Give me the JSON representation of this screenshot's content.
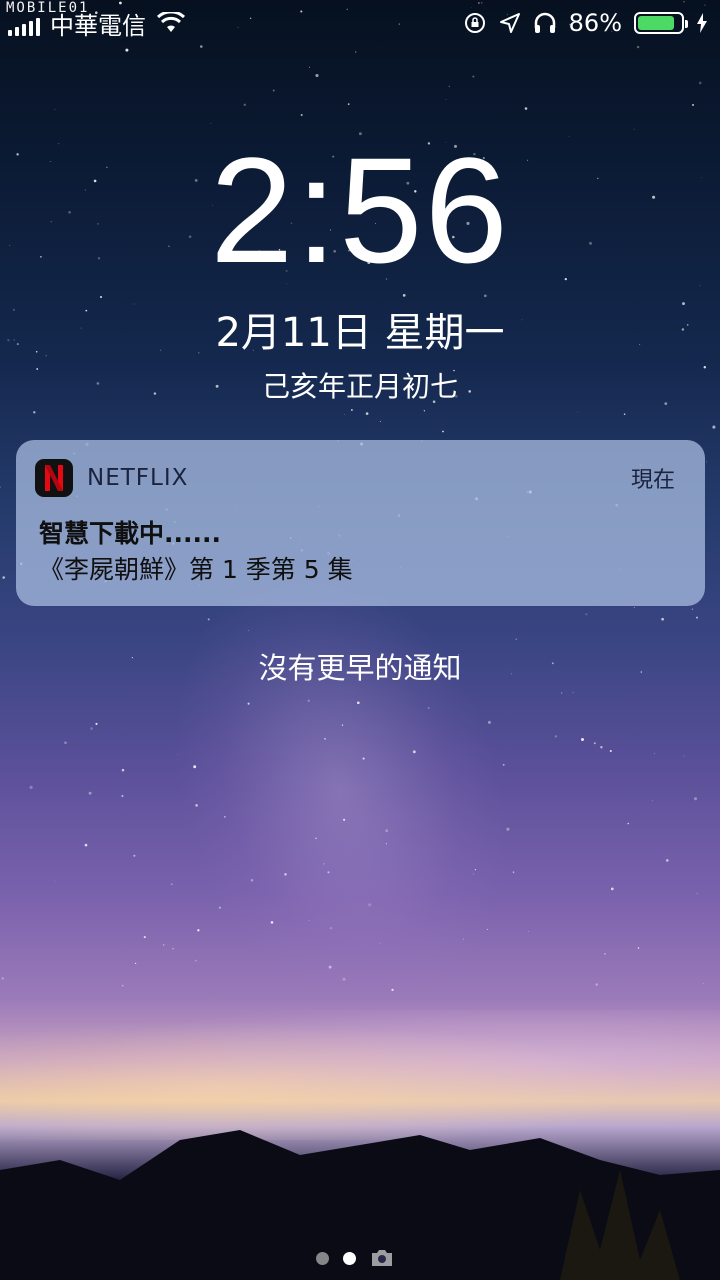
{
  "status_bar": {
    "watermark": "MOBILE01",
    "carrier": "中華電信",
    "battery_text": "86%",
    "battery_level": 0.86,
    "battery_color": "#4cd964",
    "icons": [
      "signal-icon",
      "wifi-icon",
      "rotation-lock-icon",
      "location-icon",
      "headphones-icon",
      "battery-icon",
      "charging-icon"
    ]
  },
  "lock_screen": {
    "time": "2:56",
    "date": "2月11日 星期一",
    "lunar_date": "己亥年正月初七"
  },
  "notification": {
    "app_name": "NETFLIX",
    "app_icon": "netflix-icon",
    "time": "現在",
    "title": "智慧下載中......",
    "body": "《李屍朝鮮》第 1 季第 5 集"
  },
  "no_earlier_notifications": "沒有更早的通知",
  "page_indicator": {
    "pages": 2,
    "current": 2,
    "camera_icon": "camera-icon"
  }
}
